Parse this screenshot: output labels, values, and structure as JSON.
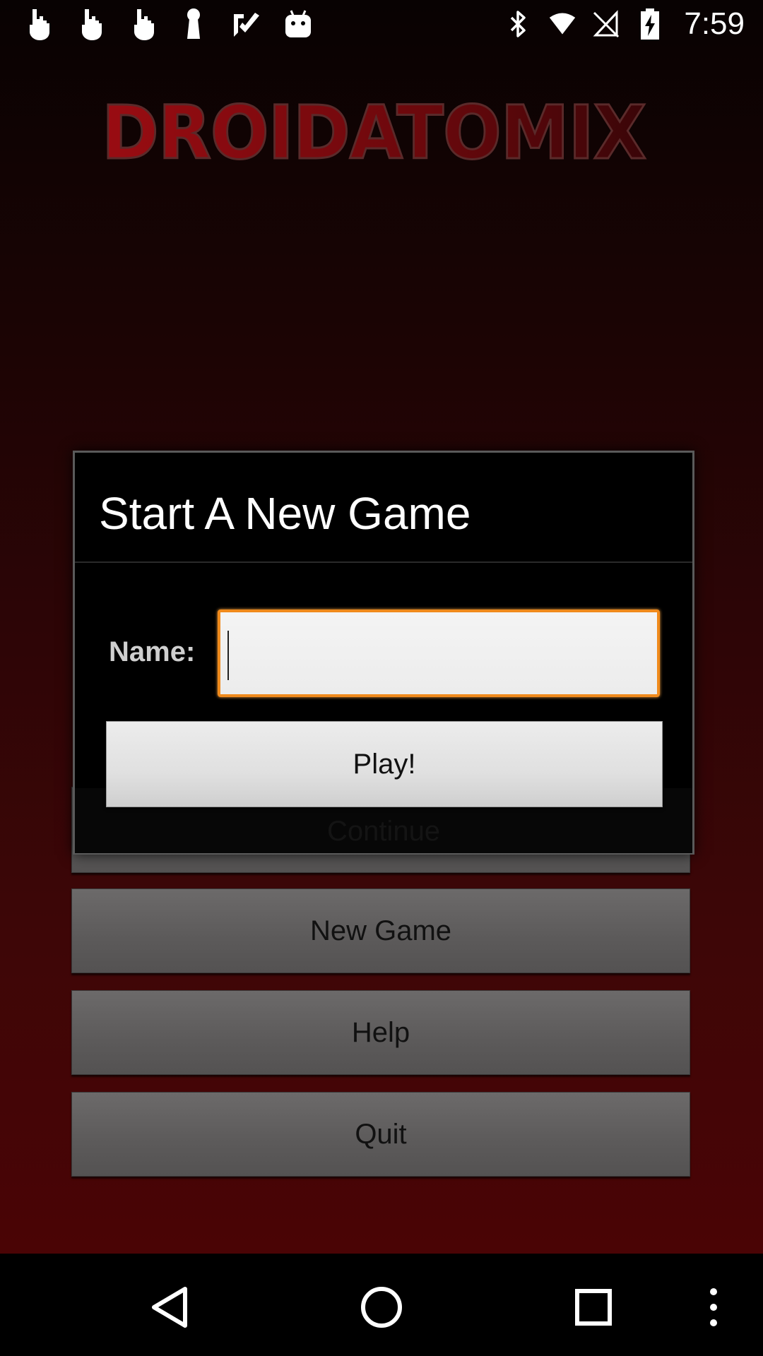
{
  "status_bar": {
    "time": "7:59",
    "left_icons": [
      "hand-icon",
      "hand-icon",
      "hand-icon",
      "keyhole-icon",
      "checkmark-icon",
      "android-icon"
    ],
    "right_icons": [
      "bluetooth-icon",
      "wifi-icon",
      "no-sim-icon",
      "battery-charging-icon"
    ]
  },
  "app": {
    "logo_text": "DROIDATOMIX",
    "menu": {
      "continue_label": "Continue",
      "new_game_label": "New Game",
      "help_label": "Help",
      "quit_label": "Quit"
    }
  },
  "dialog": {
    "title": "Start A New Game",
    "name_label": "Name:",
    "name_value": "",
    "play_label": "Play!"
  },
  "nav_bar": {
    "buttons": [
      "back-icon",
      "home-icon",
      "recents-icon",
      "menu-icon"
    ]
  },
  "colors": {
    "accent_focus": "#f08a1c",
    "logo_red": "#8a0a10"
  }
}
